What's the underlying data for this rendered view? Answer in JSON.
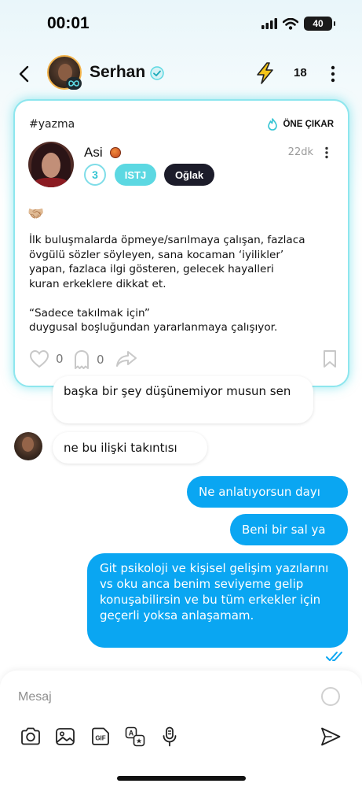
{
  "status_bar": {
    "time": "00:01",
    "battery": "40"
  },
  "header": {
    "name": "Serhan",
    "count": "18"
  },
  "post": {
    "tag": "#yazma",
    "featured_label": "ÖNE ÇIKAR",
    "author": "Asi",
    "time": "22dk",
    "level": "3",
    "mbti": "ISTJ",
    "zodiac": "Oğlak",
    "emoji": "🤝🏼",
    "body": "İlk buluşmalarda öpmeye/sarılmaya çalışan, fazlaca\növgülü sözler söyleyen, sana kocaman ‘iyilikler’\nyapan, fazlaca ilgi gösteren, gelecek hayalleri\nkuran erkeklere dikkat et.\n\n“Sadece takılmak için”\nduygusal boşluğundan yararlanmaya çalışıyor.",
    "likes": "0",
    "comments": "0"
  },
  "messages": [
    {
      "direction": "in",
      "text": "başka bir şey düşünemiyor musun sen"
    },
    {
      "direction": "in",
      "text": "ne bu ilişki takıntısı"
    },
    {
      "direction": "out",
      "text": "Ne anlatıyorsun dayı"
    },
    {
      "direction": "out",
      "text": "Beni bir sal ya"
    },
    {
      "direction": "out",
      "text": "Git psikoloji ve kişisel gelişim yazılarını vs oku anca benim seviyeme gelip konuşabilirsin ve bu tüm erkekler için geçerli yoksa anlaşamam."
    }
  ],
  "composer": {
    "placeholder": "Mesaj",
    "value": ""
  },
  "colors": {
    "accent": "#0aa6f2",
    "card_glow": "#8ee6ee",
    "mbti_pill": "#5cd8e2",
    "zodiac_pill": "#1c1c2a",
    "bolt": "#f5c518"
  }
}
